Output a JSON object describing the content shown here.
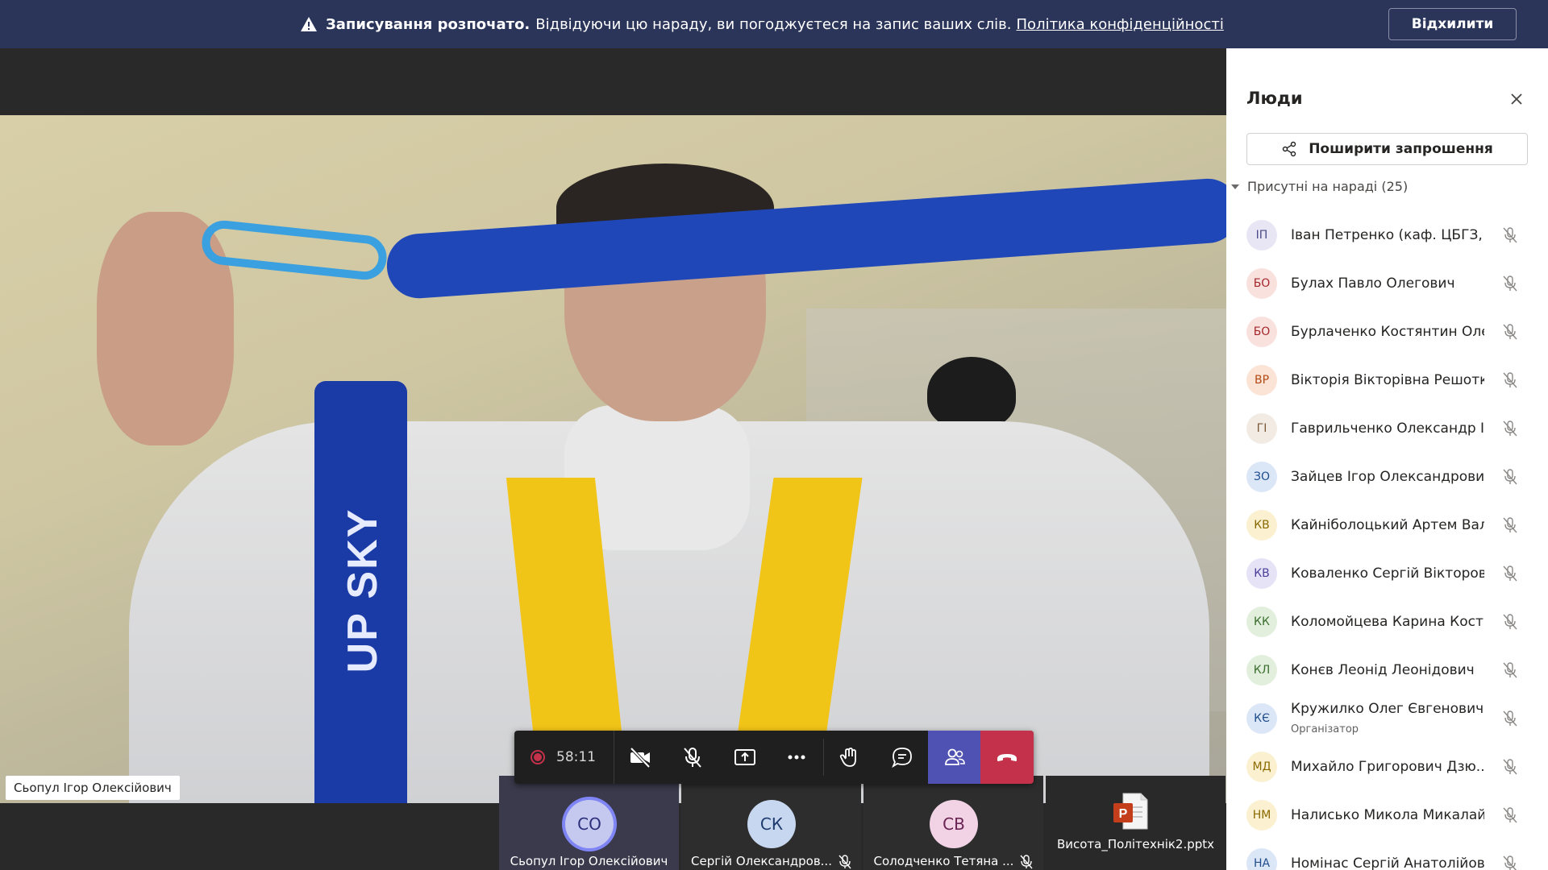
{
  "banner": {
    "bold": "Записування розпочато.",
    "text": "Відвідуючи цю нараду, ви погоджуєтеся на запис ваших слів.",
    "link": "Політика конфіденційності",
    "dismiss": "Відхилити",
    "icon": "warning-icon"
  },
  "video": {
    "speaker_name": "Сьопул Ігор Олексійович",
    "strap_text": "UP SKY"
  },
  "toolbar": {
    "timer": "58:11",
    "icons": [
      "record-icon",
      "camera-off-icon",
      "mic-off-icon",
      "share-screen-icon",
      "more-icon",
      "raise-hand-icon",
      "chat-icon",
      "people-icon",
      "hang-up-icon"
    ]
  },
  "tiles": [
    {
      "initials": "СО",
      "name": "Сьопул Ігор Олексійович",
      "muted": false
    },
    {
      "initials": "СК",
      "name": "Сергій Олександров...",
      "muted": true
    },
    {
      "initials": "СВ",
      "name": "Солодченко Тетяна ...",
      "muted": true
    },
    {
      "file": "Висота_Політехнік2.pptx",
      "icon": "powerpoint-icon"
    }
  ],
  "panel": {
    "title": "Люди",
    "share": "Поширити запрошення",
    "section": "Присутні на нараді (25)",
    "participants": [
      {
        "initials": "ІП",
        "name": "Іван Петренко (каф. ЦБГЗ, ...",
        "color": "#e8e6f4",
        "fg": "#4b4a8a"
      },
      {
        "initials": "БО",
        "name": "Булах Павло Олегович",
        "color": "#f9e1de",
        "fg": "#a4262c"
      },
      {
        "initials": "БО",
        "name": "Бурлаченко Костянтин Оле...",
        "color": "#f9e1de",
        "fg": "#a4262c"
      },
      {
        "initials": "ВР",
        "name": "Вікторія Вікторівна Решотка",
        "color": "#fbe3d6",
        "fg": "#b34a14"
      },
      {
        "initials": "ГІ",
        "name": "Гаврильченко Олександр І...",
        "color": "#f1ebe4",
        "fg": "#7a5a3a"
      },
      {
        "initials": "ЗО",
        "name": "Зайцев Ігор Олександрович",
        "color": "#dbe6f7",
        "fg": "#1f4d8c"
      },
      {
        "initials": "КВ",
        "name": "Кайніболоцький Артем Вал...",
        "color": "#fbf0cf",
        "fg": "#8a6a00"
      },
      {
        "initials": "КВ",
        "name": "Коваленко Сергій Вікторов...",
        "color": "#e6e3f7",
        "fg": "#4b3f9a"
      },
      {
        "initials": "КК",
        "name": "Коломойцева Карина Кост...",
        "color": "#e2efdd",
        "fg": "#3b6e2e"
      },
      {
        "initials": "КЛ",
        "name": "Конєв Леонід Леонідович",
        "color": "#e2efdd",
        "fg": "#3b6e2e"
      },
      {
        "initials": "КЄ",
        "name": "Кружилко Олег Євгенович",
        "role": "Організатор",
        "color": "#dbe6f7",
        "fg": "#1f4d8c"
      },
      {
        "initials": "МД",
        "name": "Михайло Григорович Дзю...",
        "color": "#fbf0cf",
        "fg": "#8a6a00"
      },
      {
        "initials": "НМ",
        "name": "Налисько Микола Микалай...",
        "color": "#fbf0cf",
        "fg": "#8a6a00"
      },
      {
        "initials": "НА",
        "name": "Номінас Сергій Анатолійов...",
        "color": "#dbe6f7",
        "fg": "#1f4d8c"
      }
    ]
  }
}
